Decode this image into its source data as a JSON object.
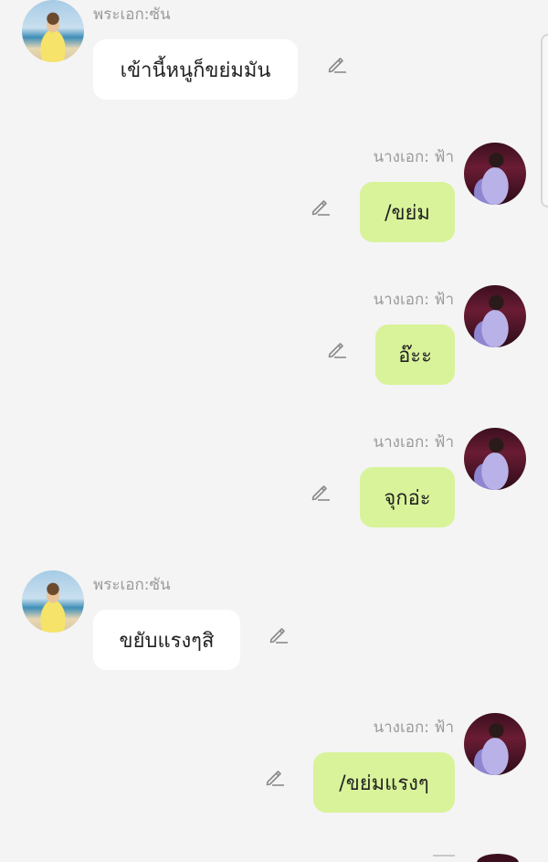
{
  "messages": [
    {
      "side": "left",
      "sender": "พระเอก:ซัน",
      "text": "เข้านี้หนูก็ขย่มมัน"
    },
    {
      "side": "right",
      "sender": "นางเอก: ฟ้า",
      "text": "/ขย่ม"
    },
    {
      "side": "right",
      "sender": "นางเอก: ฟ้า",
      "text": "อ๊ะะ"
    },
    {
      "side": "right",
      "sender": "นางเอก: ฟ้า",
      "text": "จุกอ่ะ"
    },
    {
      "side": "left",
      "sender": "พระเอก:ซัน",
      "text": "ขยับแรงๆสิ"
    },
    {
      "side": "right",
      "sender": "นางเอก: ฟ้า",
      "text": "/ขย่มแรงๆ"
    }
  ],
  "icons": {
    "edit": "pencil-icon",
    "avatar_sun": "avatar-photo-sun",
    "avatar_fah": "avatar-photo-fah"
  },
  "colors": {
    "background": "#f4f4f4",
    "left_bubble": "#ffffff",
    "right_bubble": "#d9f39a",
    "sender_text": "#9a9a9a",
    "message_text": "#222222"
  }
}
